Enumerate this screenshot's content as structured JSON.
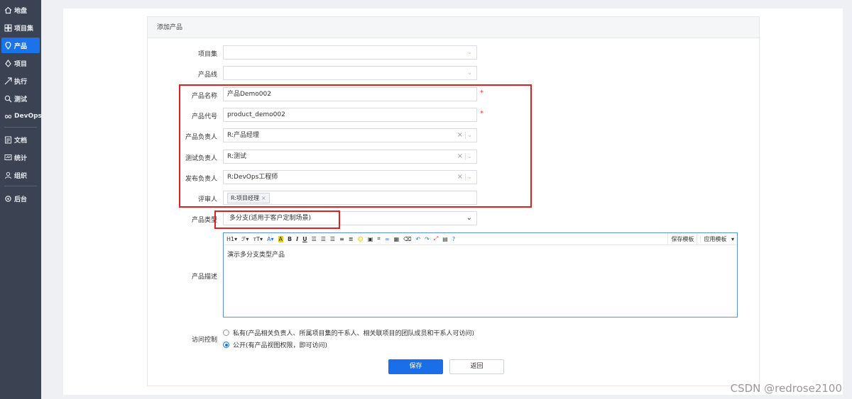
{
  "sidebar": {
    "items": [
      {
        "label": "地盘",
        "icon": "home-icon"
      },
      {
        "label": "项目集",
        "icon": "grid-icon"
      },
      {
        "label": "产品",
        "icon": "location-pin-icon",
        "active": true
      },
      {
        "label": "项目",
        "icon": "flag-icon"
      },
      {
        "label": "执行",
        "icon": "send-icon"
      },
      {
        "label": "测试",
        "icon": "magnifier-icon"
      },
      {
        "label": "DevOps",
        "icon": "infinity-icon"
      },
      {
        "label": "文档",
        "icon": "document-icon"
      },
      {
        "label": "统计",
        "icon": "chart-icon"
      },
      {
        "label": "组织",
        "icon": "people-icon"
      },
      {
        "label": "后台",
        "icon": "gear-icon"
      }
    ]
  },
  "panel": {
    "title": "添加产品"
  },
  "form": {
    "program": {
      "label": "项目集",
      "value": ""
    },
    "line": {
      "label": "产品线",
      "value": ""
    },
    "name": {
      "label": "产品名称",
      "value": "产品Demo002"
    },
    "code": {
      "label": "产品代号",
      "value": "product_demo002"
    },
    "po": {
      "label": "产品负责人",
      "value": "R:产品经理"
    },
    "qd": {
      "label": "测试负责人",
      "value": "R:测试"
    },
    "rd": {
      "label": "发布负责人",
      "value": "R:DevOps工程师"
    },
    "reviewer": {
      "label": "评审人",
      "tag": "R:项目经理"
    },
    "type": {
      "label": "产品类型",
      "value": "多分支(适用于客户定制场景)"
    },
    "desc": {
      "label": "产品描述",
      "content": "演示多分支类型产品"
    },
    "acl": {
      "label": "访问控制",
      "options": [
        {
          "label": "私有(产品相关负责人、所属项目集的干系人、相关联项目的团队成员和干系人可访问)",
          "checked": false
        },
        {
          "label": "公开(有产品视图权限，即可访问)",
          "checked": true
        }
      ]
    }
  },
  "editor": {
    "toolbar": {
      "heading": "H1",
      "font": "ℱ",
      "size": "тT",
      "save_template": "保存模板",
      "apply_template": "应用模板"
    }
  },
  "buttons": {
    "save": "保存",
    "back": "返回"
  },
  "watermark": "CSDN @redrose2100",
  "colors": {
    "sidebar_bg": "#3b4252",
    "accent": "#1a73e8",
    "highlight_box": "#e02020"
  }
}
